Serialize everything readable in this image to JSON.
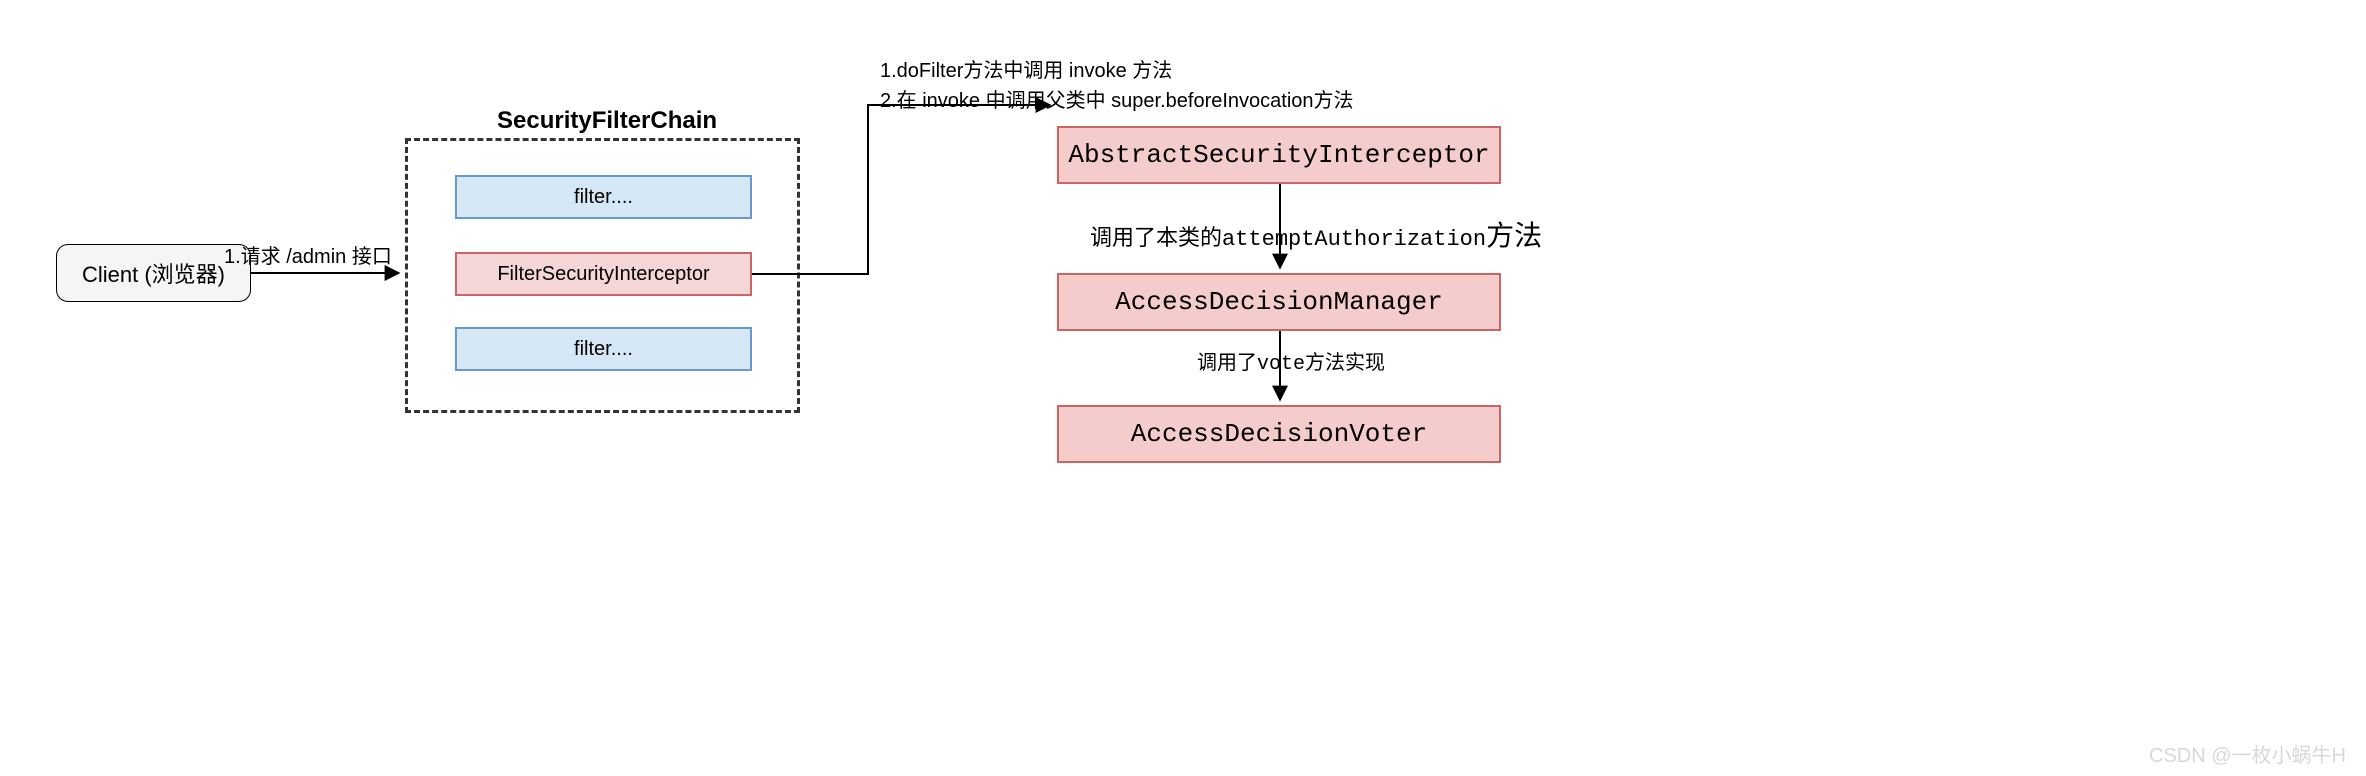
{
  "client": {
    "label": "Client (浏览器)"
  },
  "arrows": {
    "request_label": "1.请求 /admin 接口"
  },
  "chain": {
    "title": "SecurityFilterChain",
    "filter_top": "filter....",
    "filter_interceptor": "FilterSecurityInterceptor",
    "filter_bottom": "filter...."
  },
  "call_notes": {
    "line1": "1.doFilter方法中调用 invoke 方法",
    "line2": "2.在 invoke 中调用父类中 super.beforeInvocation方法"
  },
  "stack": {
    "interceptor": "AbstractSecurityInterceptor",
    "note1_prefix": "调用了本类的",
    "note1_code": "attemptAuthorization",
    "note1_suffix": "方法",
    "manager": "AccessDecisionManager",
    "note2_prefix": "调用了",
    "note2_code": "vote",
    "note2_suffix": "方法实现",
    "voter": "AccessDecisionVoter"
  },
  "watermark": "CSDN @一枚小蜗牛H"
}
